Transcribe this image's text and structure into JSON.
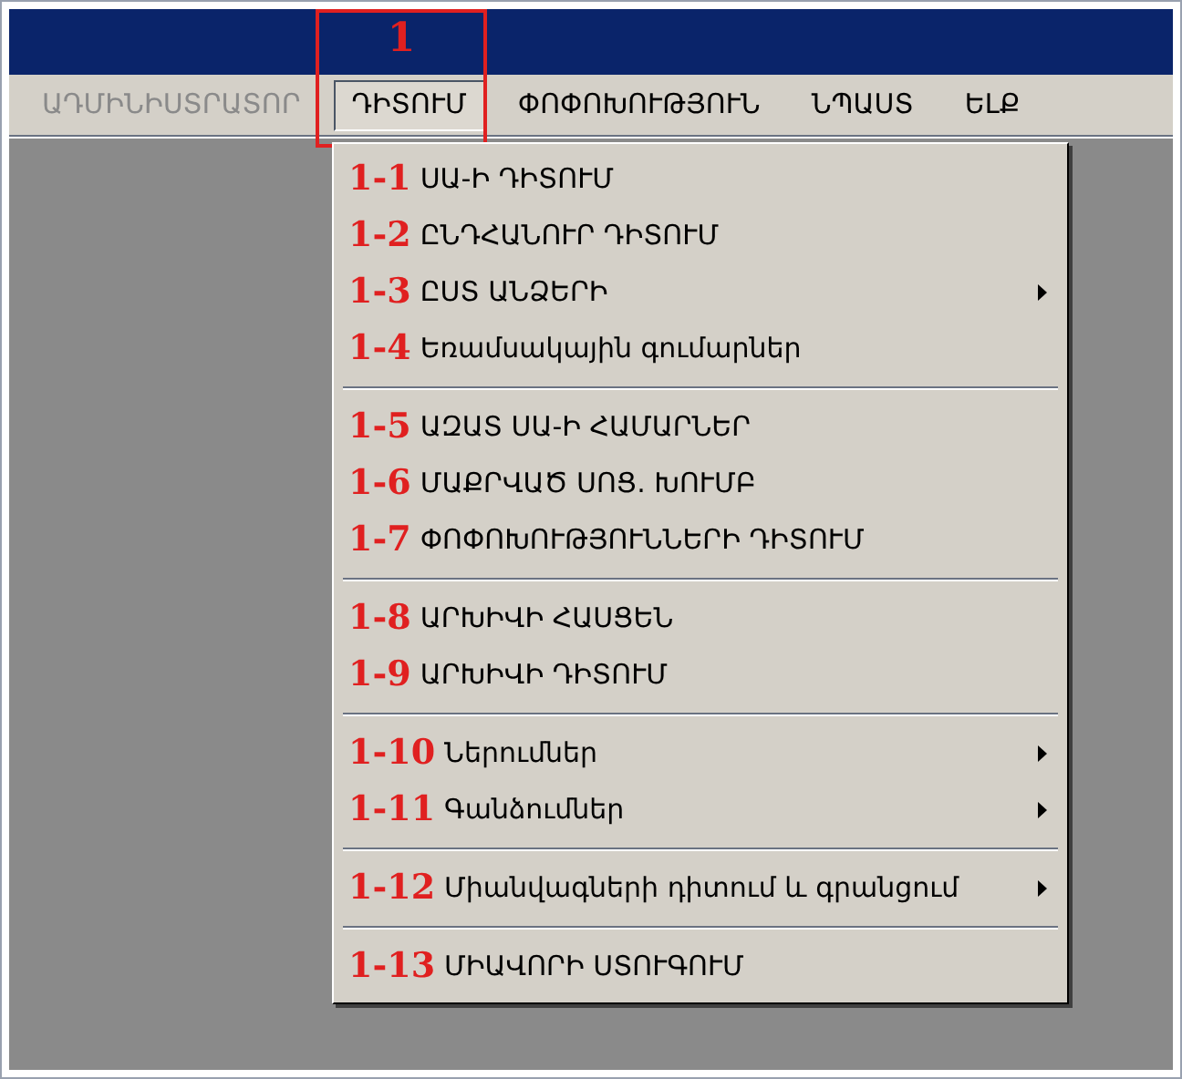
{
  "annotation": {
    "label": "1"
  },
  "menu_bar": [
    {
      "label": "ԱԴՄԻՆԻՍՏՐԱՏՈՐ",
      "disabled": true,
      "selected": false
    },
    {
      "label": "ԴԻՏՈՒՄ",
      "disabled": false,
      "selected": true
    },
    {
      "label": "ՓՈՓՈԽՈՒԹՅՈՒՆ",
      "disabled": false,
      "selected": false
    },
    {
      "label": "ՆՊԱՍՏ",
      "disabled": false,
      "selected": false
    },
    {
      "label": "ԵԼՔ",
      "disabled": false,
      "selected": false
    }
  ],
  "menu_groups": [
    [
      {
        "number": "1-1",
        "label": "ՍԱ-Ի ԴԻՏՈՒՄ",
        "submenu": false
      },
      {
        "number": "1-2",
        "label": "ԸՆԴՀԱՆՈՒՐ ԴԻՏՈՒՄ",
        "submenu": false
      },
      {
        "number": "1-3",
        "label": "ԸՍՏ ԱՆՁԵՐԻ",
        "submenu": true
      },
      {
        "number": "1-4",
        "label": "Եռամսակային գումարներ",
        "submenu": false
      }
    ],
    [
      {
        "number": "1-5",
        "label": "ԱԶԱՏ ՍԱ-Ի ՀԱՄԱՐՆԵՐ",
        "submenu": false
      },
      {
        "number": "1-6",
        "label": "ՄԱՔՐՎԱԾ ՍՈՑ. ԽՈՒՄԲ",
        "submenu": false
      },
      {
        "number": "1-7",
        "label": "ՓՈՓՈԽՈՒԹՅՈՒՆՆԵՐԻ ԴԻՏՈՒՄ",
        "submenu": false
      }
    ],
    [
      {
        "number": "1-8",
        "label": "ԱՐԽԻՎԻ ՀԱՍՑԵՆ",
        "submenu": false
      },
      {
        "number": "1-9",
        "label": "ԱՐԽԻՎԻ ԴԻՏՈՒՄ",
        "submenu": false
      }
    ],
    [
      {
        "number": "1-10",
        "label": "Ներումներ",
        "submenu": true
      },
      {
        "number": "1-11",
        "label": "Գանձումներ",
        "submenu": true
      }
    ],
    [
      {
        "number": "1-12",
        "label": "Միանվագների դիտում և գրանցում",
        "submenu": true
      }
    ],
    [
      {
        "number": "1-13",
        "label": "ՄԻԱՎՈՐԻ ՍՏՈՒԳՈՒՄ",
        "submenu": false
      }
    ]
  ]
}
